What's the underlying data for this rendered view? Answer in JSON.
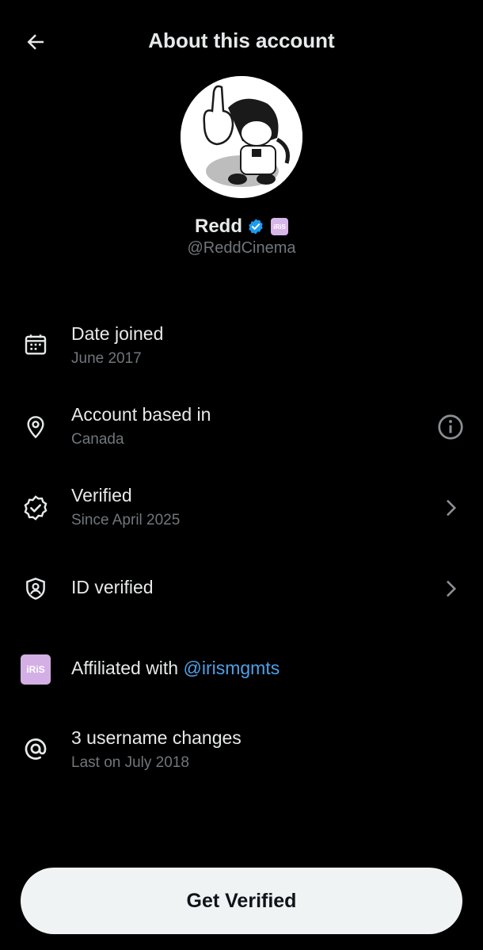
{
  "header": {
    "title": "About this account",
    "back_icon": "arrow-left-icon"
  },
  "profile": {
    "name": "Redd",
    "handle": "@ReddCinema",
    "verified_badge_color": "#1d9bf0",
    "affiliate_badge_color": "#d4afe5",
    "affiliate_badge_text": "iRiS"
  },
  "details": [
    {
      "icon": "calendar-icon",
      "label": "Date joined",
      "sub": "June 2017"
    },
    {
      "icon": "location-pin-icon",
      "label": "Account based in",
      "sub": "Canada",
      "action_icon": "info-icon"
    },
    {
      "icon": "verified-badge-icon",
      "label": "Verified",
      "sub": "Since April 2025",
      "action_icon": "chevron-right-icon"
    },
    {
      "icon": "id-shield-icon",
      "label": "ID verified",
      "action_icon": "chevron-right-icon"
    },
    {
      "icon": "affiliate-logo-icon",
      "label_prefix": "Affiliated with",
      "link": "@irismgmts"
    },
    {
      "icon": "at-sign-icon",
      "label": "3 username changes",
      "sub": "Last on July 2018"
    }
  ],
  "cta": {
    "label": "Get Verified"
  },
  "colors": {
    "background": "#000000",
    "text": "#e7e9ea",
    "muted": "#71767b",
    "link": "#4ea0e8",
    "button_bg": "#eff3f4"
  }
}
